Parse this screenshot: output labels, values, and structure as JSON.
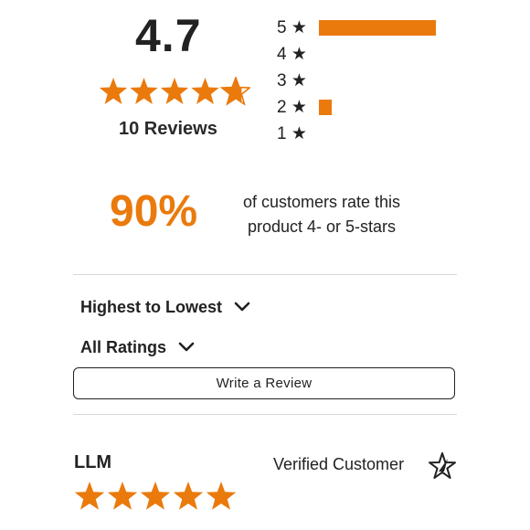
{
  "summary": {
    "average": "4.7",
    "average_value": 4.7,
    "stars_max": 5,
    "review_count_text": "10 Reviews"
  },
  "distribution": [
    {
      "label": "5 ★",
      "fraction": 0.9
    },
    {
      "label": "4 ★",
      "fraction": 0
    },
    {
      "label": "3 ★",
      "fraction": 0
    },
    {
      "label": "2 ★",
      "fraction": 0.1
    },
    {
      "label": "1 ★",
      "fraction": 0
    }
  ],
  "recommend": {
    "percent_text": "90%",
    "line1": "of customers rate this",
    "line2": "product 4- or 5-stars"
  },
  "controls": {
    "sort_label": "Highest to Lowest",
    "filter_label": "All Ratings",
    "write_review_label": "Write a Review"
  },
  "review": {
    "author": "LLM",
    "badge_text": "Verified Customer",
    "badge_icon": "verified-star-icon",
    "rating": 5
  },
  "colors": {
    "accent": "#ea7a0c",
    "text": "#222222",
    "divider": "#d8d8d8"
  }
}
